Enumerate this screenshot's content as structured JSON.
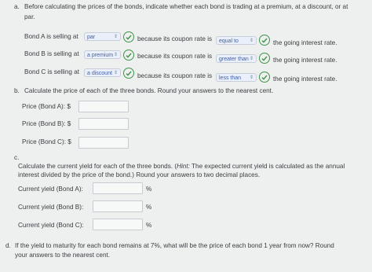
{
  "part_a": {
    "marker": "a.",
    "intro_line1": "Before calculating the prices of the bonds, indicate whether each bond is trading at a premium, at a discount, or at",
    "intro_line2": "par.",
    "rows": [
      {
        "prefix": "Bond A is selling at",
        "selected_status": "par",
        "middle": "because its coupon rate is",
        "selected_comparison": "equal to",
        "suffix": "the going interest rate."
      },
      {
        "prefix": "Bond B is selling at",
        "selected_status": "a premium",
        "middle": "because its coupon rate is",
        "selected_comparison": "greater than",
        "suffix": "the going interest rate."
      },
      {
        "prefix": "Bond C is selling at",
        "selected_status": "a discount",
        "middle": "because its coupon rate is",
        "selected_comparison": "less than",
        "suffix": "the going interest rate."
      }
    ]
  },
  "part_b": {
    "marker": "b.",
    "text": "Calculate the price of each of the three bonds. Round your answers to the nearest cent.",
    "fields": [
      {
        "label": "Price (Bond A): $",
        "value": ""
      },
      {
        "label": "Price (Bond B): $",
        "value": ""
      },
      {
        "label": "Price (Bond C): $",
        "value": ""
      }
    ]
  },
  "part_c": {
    "marker": "c.",
    "line1_pre": "Calculate the current yield for each of the three bonds. (",
    "line1_hint": "Hint:",
    "line1_post": " The expected current yield is calculated as the annual",
    "line2": "interest divided by the price of the bond.) Round your answers to two decimal places.",
    "unit": "%",
    "fields": [
      {
        "label": "Current yield (Bond A):",
        "value": ""
      },
      {
        "label": "Current yield (Bond B):",
        "value": ""
      },
      {
        "label": "Current yield (Bond C):",
        "value": ""
      }
    ]
  },
  "part_d": {
    "marker": "d.",
    "line1": "If the yield to maturity for each bond remains at 7%, what will be the price of each bond 1 year from now? Round",
    "line2": "your answers to the nearest cent."
  },
  "icons": {
    "check": "check-circle-icon",
    "dropdown": "chevron-up-down-icon"
  },
  "colors": {
    "check_green": "#3d9448",
    "select_text": "#3d5ea8",
    "select_bg": "#eaf0fb"
  }
}
